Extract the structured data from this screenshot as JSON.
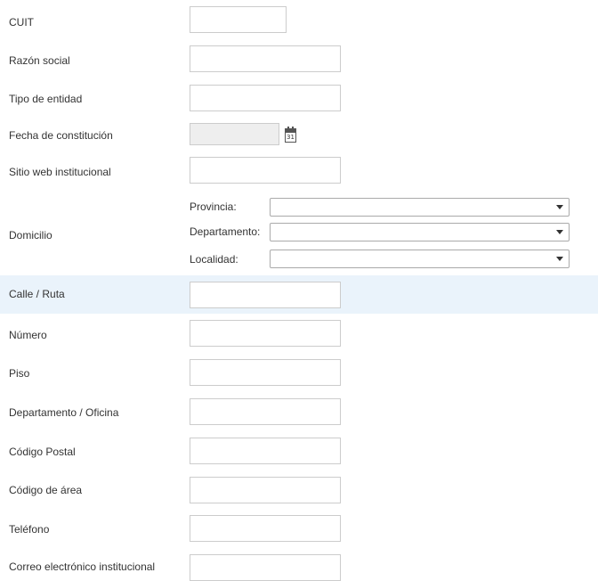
{
  "form": {
    "cuit": {
      "label": "CUIT",
      "value": ""
    },
    "razon_social": {
      "label": "Razón social",
      "value": ""
    },
    "tipo_entidad": {
      "label": "Tipo de entidad",
      "value": ""
    },
    "fecha_constitucion": {
      "label": "Fecha de constitución",
      "value": "",
      "calendar_day": "31"
    },
    "sitio_web": {
      "label": "Sitio web institucional",
      "value": ""
    },
    "domicilio": {
      "label": "Domicilio",
      "provincia": {
        "label": "Provincia:",
        "value": ""
      },
      "departamento": {
        "label": "Departamento:",
        "value": ""
      },
      "localidad": {
        "label": "Localidad:",
        "value": ""
      }
    },
    "calle": {
      "label": "Calle / Ruta",
      "value": ""
    },
    "numero": {
      "label": "Número",
      "value": ""
    },
    "piso": {
      "label": "Piso",
      "value": ""
    },
    "depto_oficina": {
      "label": "Departamento / Oficina",
      "value": ""
    },
    "codigo_postal": {
      "label": "Código Postal",
      "value": ""
    },
    "codigo_area": {
      "label": "Código de área",
      "value": ""
    },
    "telefono": {
      "label": "Teléfono",
      "value": ""
    },
    "correo": {
      "label": "Correo electrónico institucional",
      "value": ""
    }
  },
  "icons": {
    "calendar": "calendar-icon",
    "dropdown": "chevron-down-icon"
  },
  "colors": {
    "highlight_row": "#eaf3fb",
    "border": "#cccccc",
    "text": "#333333"
  }
}
